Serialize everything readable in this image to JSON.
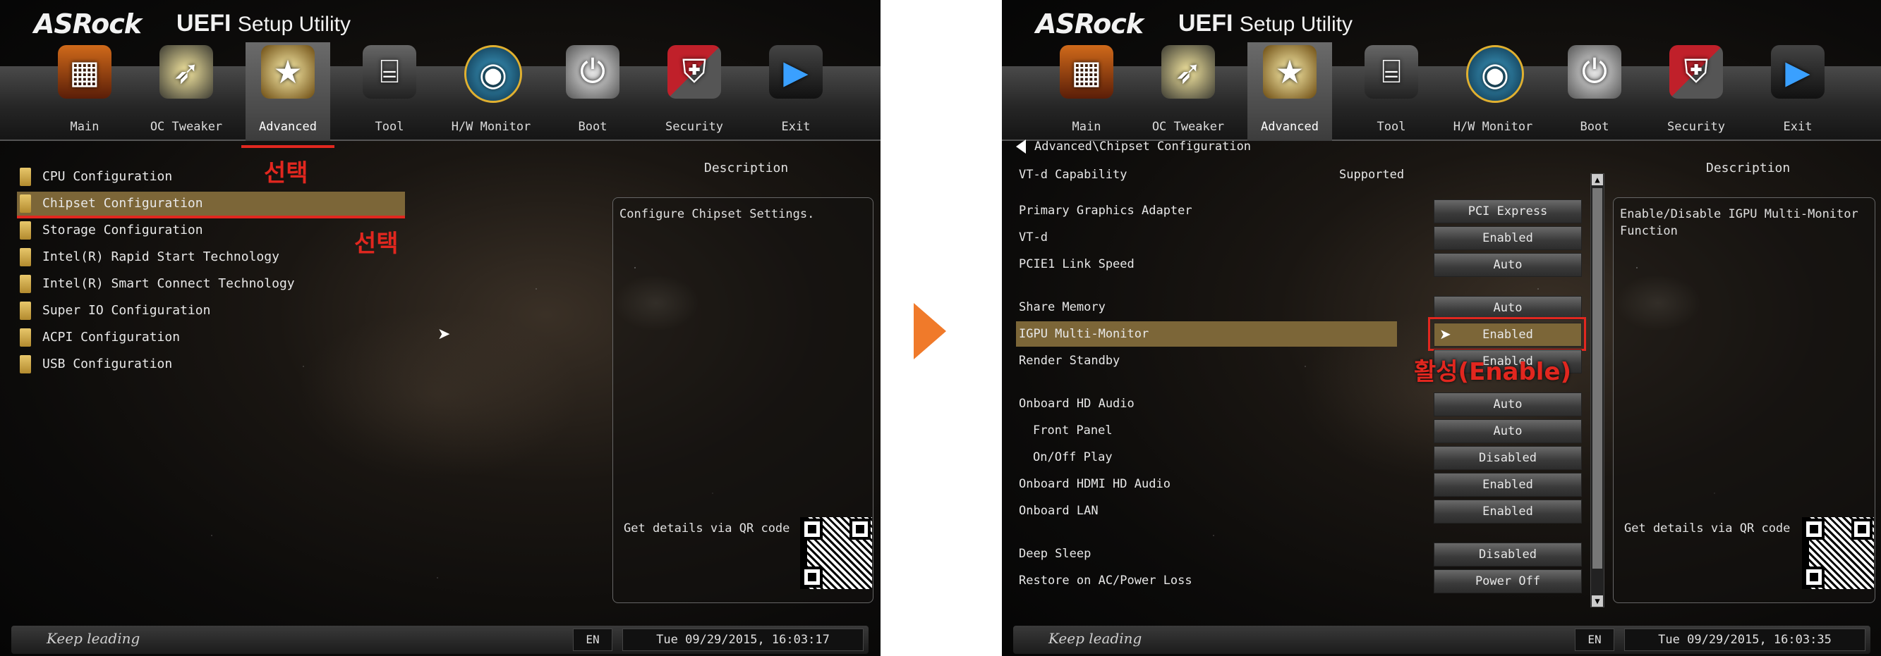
{
  "brand": {
    "logo": "ASRock",
    "title_bold": "UEFI",
    "title_rest": "Setup Utility"
  },
  "nav_items": [
    {
      "label": "Main",
      "icon": "main-icon"
    },
    {
      "label": "OC Tweaker",
      "icon": "rocket-icon"
    },
    {
      "label": "Advanced",
      "icon": "star-icon"
    },
    {
      "label": "Tool",
      "icon": "toolbox-icon"
    },
    {
      "label": "H/W Monitor",
      "icon": "radar-icon"
    },
    {
      "label": "Boot",
      "icon": "joystick-icon"
    },
    {
      "label": "Security",
      "icon": "shield-icon"
    },
    {
      "label": "Exit",
      "icon": "exit-icon"
    }
  ],
  "left": {
    "menu": [
      "CPU Configuration",
      "Chipset Configuration",
      "Storage Configuration",
      "Intel(R) Rapid Start Technology",
      "Intel(R) Smart Connect Technology",
      "Super IO Configuration",
      "ACPI Configuration",
      "USB Configuration"
    ],
    "description_title": "Description",
    "description_text": "Configure Chipset Settings.",
    "qr_text": "Get details via QR code",
    "annotation_tab": "선택",
    "annotation_item": "선택",
    "lang": "EN",
    "datetime": "Tue 09/29/2015, 16:03:17"
  },
  "right": {
    "breadcrumb": "Advanced\\Chipset Configuration",
    "vtd_capability": {
      "label": "VT-d Capability",
      "value": "Supported"
    },
    "settings": [
      {
        "label": "Primary Graphics Adapter",
        "value": "PCI Express"
      },
      {
        "label": "VT-d",
        "value": "Enabled"
      },
      {
        "label": "PCIE1 Link Speed",
        "value": "Auto"
      },
      {
        "label": "Share Memory",
        "value": "Auto"
      },
      {
        "label": "IGPU Multi-Monitor",
        "value": "Enabled"
      },
      {
        "label": "Render Standby",
        "value": "Enabled"
      },
      {
        "label": "Onboard HD Audio",
        "value": "Auto"
      },
      {
        "label": "Front Panel",
        "value": "Auto"
      },
      {
        "label": "On/Off Play",
        "value": "Disabled"
      },
      {
        "label": "Onboard HDMI HD Audio",
        "value": "Enabled"
      },
      {
        "label": "Onboard LAN",
        "value": "Enabled"
      },
      {
        "label": "Deep Sleep",
        "value": "Disabled"
      },
      {
        "label": "Restore on AC/Power Loss",
        "value": "Power Off"
      }
    ],
    "description_title": "Description",
    "description_text": "Enable/Disable IGPU Multi-Monitor Function",
    "qr_text": "Get details via QR code",
    "annotation": "활성(Enable)",
    "lang": "EN",
    "datetime": "Tue 09/29/2015, 16:03:35"
  },
  "footer_slogan": "Keep leading",
  "colors": {
    "highlight": "#7c6638",
    "annotation_red": "#e1271f",
    "arrow": "#f07a2a"
  }
}
